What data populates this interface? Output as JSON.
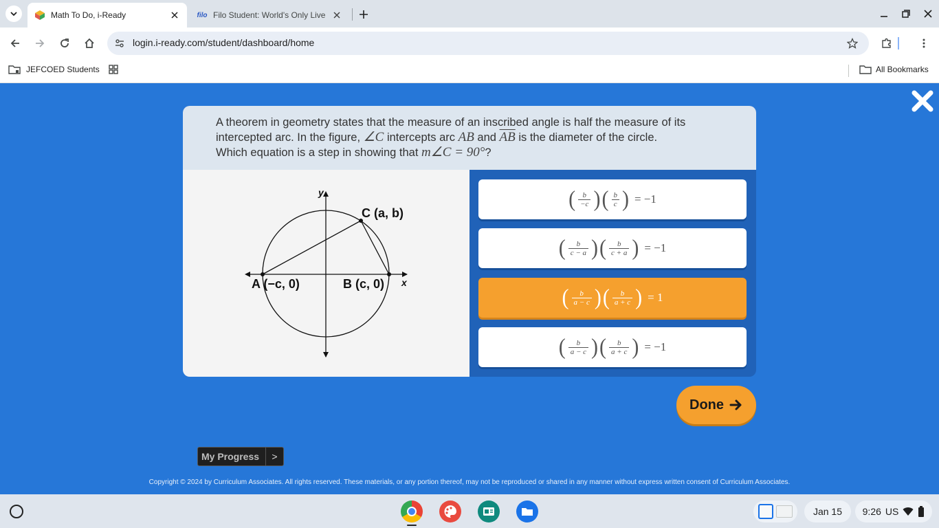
{
  "browser": {
    "tabs": [
      {
        "title": "Math To Do, i-Ready",
        "active": true
      },
      {
        "title": "Filo Student: World's Only Live",
        "active": false,
        "favicon_text": "filo"
      }
    ],
    "url": "login.i-ready.com/student/dashboard/home",
    "bookmarks": {
      "folder": "JEFCOED Students",
      "all": "All Bookmarks"
    }
  },
  "question": {
    "line1": "A theorem in geometry states that the measure of an inscribed angle is half the measure of its",
    "line2_a": "intercepted arc. In the figure,",
    "angle_c": "∠C",
    "line2_b": "intercepts arc",
    "arc_ab": "AB",
    "and": "and",
    "diam_ab": "AB",
    "line2_c": "is the diameter of the circle.",
    "line3_a": "Which equation is a step in showing that",
    "line3_math": "m∠C = 90°",
    "line3_b": "?"
  },
  "figure": {
    "y_axis": "y",
    "x_axis": "x",
    "point_c": "C (a, b)",
    "point_a": "A (−c, 0)",
    "point_b": "B (c, 0)"
  },
  "choices": [
    {
      "f1_num": "b",
      "f1_den": "−c",
      "f2_num": "b",
      "f2_den": "c",
      "rhs": "= −1",
      "selected": false
    },
    {
      "f1_num": "b",
      "f1_den": "c − a",
      "f2_num": "b",
      "f2_den": "c + a",
      "rhs": "= −1",
      "selected": false
    },
    {
      "f1_num": "b",
      "f1_den": "a − c",
      "f2_num": "b",
      "f2_den": "a + c",
      "rhs": "= 1",
      "selected": true
    },
    {
      "f1_num": "b",
      "f1_den": "a − c",
      "f2_num": "b",
      "f2_den": "a + c",
      "rhs": "= −1",
      "selected": false
    }
  ],
  "done_label": "Done",
  "progress": {
    "label": "My Progress",
    "arrow": ">"
  },
  "copyright": "Copyright © 2024 by Curriculum Associates. All rights reserved. These materials, or any portion thereof, may not be reproduced or shared in any manner without express written consent of Curriculum Associates.",
  "shelf": {
    "date": "Jan 15",
    "time": "9:26",
    "locale": "US"
  },
  "colors": {
    "page_bg": "#2677d8",
    "accent_orange": "#f5a02e",
    "prompt_bg": "#dde6ef"
  }
}
